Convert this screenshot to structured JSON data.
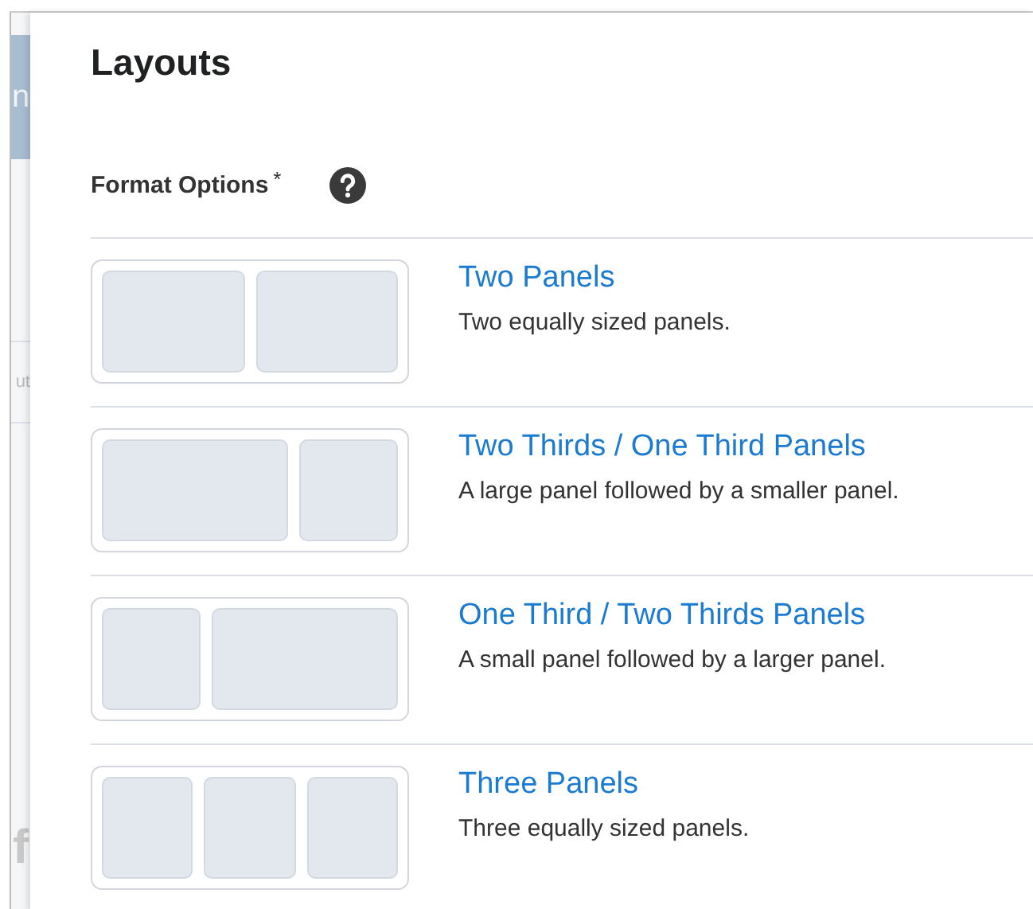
{
  "background_page": [
    {
      "text": "n",
      "kind": "highlight"
    },
    {
      "text": "ut",
      "kind": "plain"
    },
    {
      "text": "f",
      "kind": "large"
    }
  ],
  "dialog": {
    "title": "Layouts",
    "field_label": "Format Options",
    "required_mark": "*",
    "options": [
      {
        "title": "Two Panels",
        "description": "Two equally sized panels.",
        "kind": "halves"
      },
      {
        "title": "Two Thirds / One Third Panels",
        "description": "A large panel followed by a smaller panel.",
        "kind": "large_small"
      },
      {
        "title": "One Third / Two Thirds Panels",
        "description": "A small panel followed by a larger panel.",
        "kind": "small_large"
      },
      {
        "title": "Three Panels",
        "description": "Three equally sized panels.",
        "kind": "thirds"
      }
    ]
  }
}
